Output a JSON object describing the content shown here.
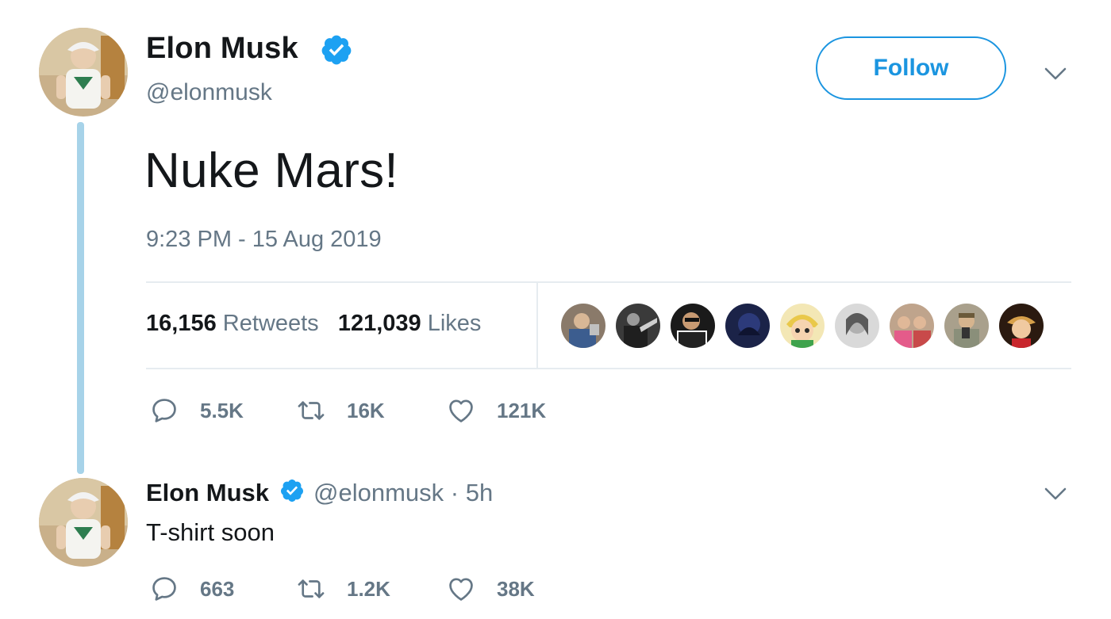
{
  "tweet": {
    "author_name": "Elon Musk",
    "handle": "@elonmusk",
    "follow_label": "Follow",
    "text": "Nuke Mars!",
    "timestamp": "9:23 PM - 15 Aug 2019",
    "retweets_count": "16,156",
    "retweets_label": "Retweets",
    "likes_count": "121,039",
    "likes_label": "Likes",
    "liker_avatar_count": 9,
    "actions": {
      "replies": "5.5K",
      "retweets": "16K",
      "likes": "121K"
    }
  },
  "reply": {
    "author_name": "Elon Musk",
    "handle": "@elonmusk",
    "separator": "·",
    "time": "5h",
    "text": "T-shirt soon",
    "actions": {
      "replies": "663",
      "retweets": "1.2K",
      "likes": "38K"
    }
  },
  "icons": {
    "verified": "verified-badge-icon",
    "menu": "chevron-down-icon",
    "reply": "reply-icon",
    "retweet": "retweet-icon",
    "like": "heart-icon"
  },
  "colors": {
    "accent": "#1b95e0",
    "verified": "#1da1f2",
    "secondary_text": "#657786",
    "thread_line": "#a7d3e9",
    "divider": "#e6ecf0"
  }
}
